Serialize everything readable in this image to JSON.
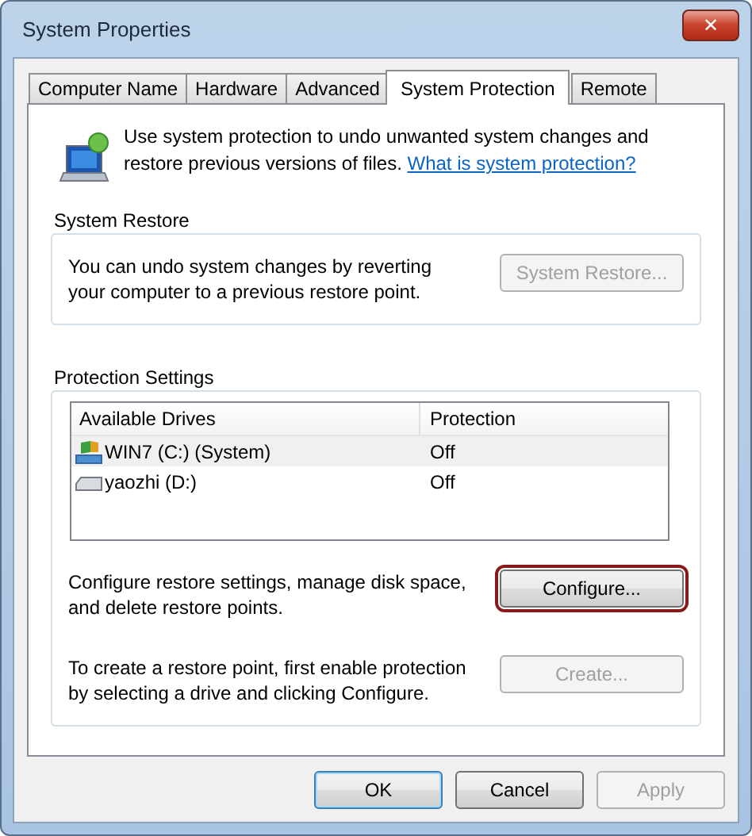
{
  "window": {
    "title": "System Properties",
    "close": "✕"
  },
  "tabs": [
    {
      "label": "Computer Name",
      "selected": false
    },
    {
      "label": "Hardware",
      "selected": false
    },
    {
      "label": "Advanced",
      "selected": false
    },
    {
      "label": "System Protection",
      "selected": true
    },
    {
      "label": "Remote",
      "selected": false
    }
  ],
  "intro": {
    "text": "Use system protection to undo unwanted system changes and restore previous versions of files.",
    "link": "What is system protection?"
  },
  "system_restore": {
    "title": "System Restore",
    "text": "You can undo system changes by reverting your computer to a previous restore point.",
    "button": {
      "label": "System Restore...",
      "disabled": true,
      "highlighted": false
    }
  },
  "protection_settings": {
    "title": "Protection Settings",
    "table": {
      "columns": [
        "Available Drives",
        "Protection"
      ],
      "rows": [
        {
          "drive": "WIN7 (C:) (System)",
          "kind": "system",
          "protection": "Off",
          "selected": true
        },
        {
          "drive": "yaozhi (D:)",
          "kind": "disk",
          "protection": "Off",
          "selected": false
        }
      ]
    },
    "configure": {
      "text": "Configure restore settings, manage disk space, and delete restore points.",
      "button": {
        "label": "Configure...",
        "disabled": false,
        "highlighted": true
      }
    },
    "create": {
      "text": "To create a restore point, first enable protection by selecting a drive and clicking Configure.",
      "button": {
        "label": "Create...",
        "disabled": true,
        "highlighted": false
      }
    }
  },
  "buttons": [
    {
      "label": "OK",
      "disabled": false,
      "default": true
    },
    {
      "label": "Cancel",
      "disabled": false,
      "default": false
    },
    {
      "label": "Apply",
      "disabled": true,
      "default": false
    }
  ]
}
